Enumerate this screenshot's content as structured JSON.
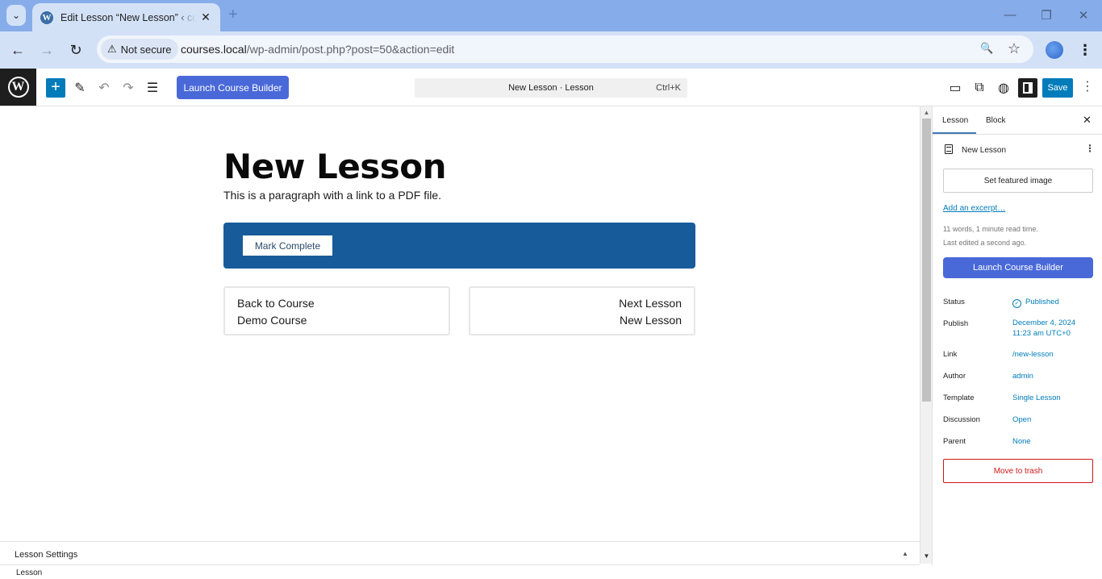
{
  "browser": {
    "tab_title": "Edit Lesson “New Lesson” ‹ courses",
    "tab_favicon": "wordpress-icon",
    "security_label": "Not secure",
    "url_host": "courses.local",
    "url_path": "/wp-admin/post.php?post=50&action=edit",
    "icons": {
      "tab_menu": "⌄",
      "tab_close": "✕",
      "new_tab": "+",
      "minimize": "—",
      "restore": "❐",
      "close": "✕",
      "back": "←",
      "forward": "→",
      "reload": "↻",
      "zoom": "🔍",
      "bookmark": "☆",
      "menu": "⋮",
      "warning": "⚠"
    }
  },
  "editor_header": {
    "logo": "W",
    "add_block": "+",
    "launch_button": "Launch Course Builder",
    "command_title": "New Lesson · Lesson",
    "command_shortcut": "Ctrl+K",
    "save_label": "Save",
    "icons": {
      "tools": "✎",
      "undo": "↶",
      "redo": "↷",
      "outline": "☰",
      "preview": "▭",
      "view_post": "⧉",
      "publish_globe": "◍",
      "more": "⋮"
    }
  },
  "content": {
    "title": "New Lesson",
    "paragraph": "This is a paragraph with a link to a PDF file.",
    "mark_complete": "Mark Complete",
    "back_card": {
      "label": "Back to Course",
      "target": "Demo Course"
    },
    "next_card": {
      "label": "Next Lesson",
      "target": "New Lesson"
    }
  },
  "metabox": {
    "title": "Lesson Settings",
    "toggle": "▲",
    "breadcrumb": "Lesson"
  },
  "scrollbar": {
    "up": "▲",
    "down": "▼"
  },
  "sidebar": {
    "tabs": [
      {
        "label": "Lesson",
        "active": true
      },
      {
        "label": "Block",
        "active": false
      }
    ],
    "close": "✕",
    "post_name": "New Lesson",
    "more": "⋮",
    "featured_image": "Set featured image",
    "excerpt_link": "Add an excerpt…",
    "word_count": "11 words, 1 minute read time.",
    "last_edited": "Last edited a second ago.",
    "launch_button": "Launch Course Builder",
    "rows": [
      {
        "label": "Status",
        "value": "Published"
      },
      {
        "label": "Publish",
        "value": "December 4, 2024",
        "value2": "11:23 am UTC+0"
      },
      {
        "label": "Link",
        "value": "/new-lesson"
      },
      {
        "label": "Author",
        "value": "admin"
      },
      {
        "label": "Template",
        "value": "Single Lesson"
      },
      {
        "label": "Discussion",
        "value": "Open"
      },
      {
        "label": "Parent",
        "value": "None"
      }
    ],
    "status_icon": "✓",
    "trash": "Move to trash"
  },
  "colors": {
    "wp_blue": "#007cba",
    "builder_blue": "#4a69d8",
    "complete_bar": "#175b9a",
    "danger": "#cc1818",
    "chrome_tabstrip": "#86acea",
    "chrome_toolbar": "#d3e1f7"
  }
}
